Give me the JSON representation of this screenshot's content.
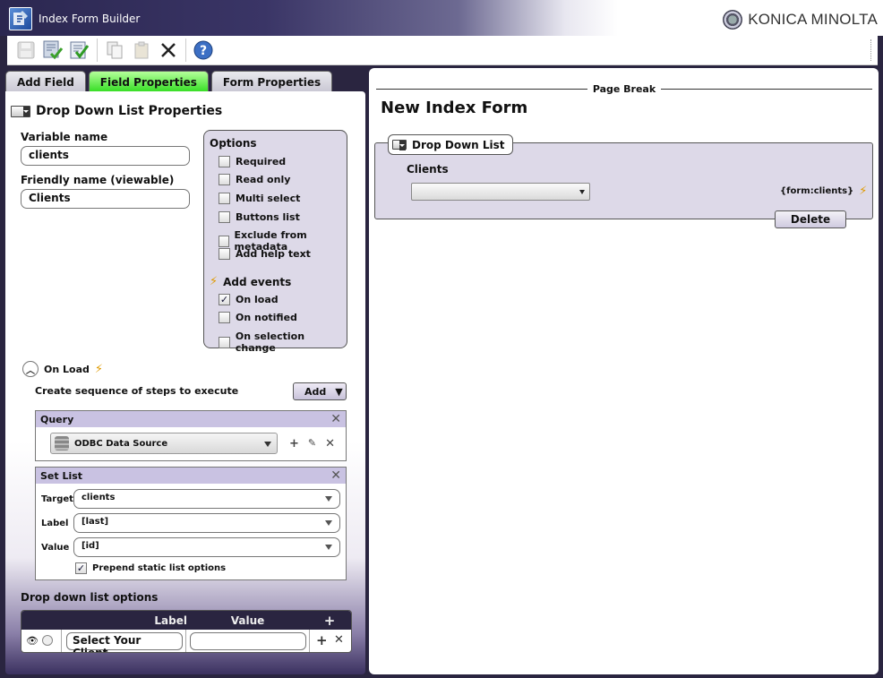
{
  "window": {
    "title": "Index Form Builder",
    "brand": "KONICA MINOLTA"
  },
  "toolbar": {
    "icons": [
      "save-icon",
      "save-and-check-icon",
      "validate-icon",
      "copy-icon",
      "paste-icon",
      "delete-icon",
      "help-icon"
    ]
  },
  "tabs": [
    {
      "label": "Add Field",
      "active": false
    },
    {
      "label": "Field Properties",
      "active": true
    },
    {
      "label": "Form Properties",
      "active": false
    }
  ],
  "properties": {
    "title": "Drop Down List Properties",
    "variable_name_label": "Variable name",
    "variable_name_value": "clients",
    "friendly_name_label": "Friendly name (viewable)",
    "friendly_name_value": "Clients"
  },
  "options": {
    "heading": "Options",
    "items": [
      {
        "label": "Required",
        "checked": false
      },
      {
        "label": "Read only",
        "checked": false
      },
      {
        "label": "Multi select",
        "checked": false
      },
      {
        "label": "Buttons list",
        "checked": false
      },
      {
        "label": "Exclude from metadata",
        "checked": false
      },
      {
        "label": "Add help text",
        "checked": false
      }
    ],
    "events_heading": "Add events",
    "events": [
      {
        "label": "On load",
        "checked": true
      },
      {
        "label": "On notified",
        "checked": false
      },
      {
        "label": "On selection change",
        "checked": false
      }
    ]
  },
  "onload": {
    "title": "On Load",
    "sequence_text": "Create sequence of steps to execute",
    "add_label": "Add",
    "query": {
      "title": "Query",
      "source": "ODBC Data Source"
    },
    "set_list": {
      "title": "Set List",
      "target_label": "Target",
      "target_value": "clients",
      "label_label": "Label",
      "label_value": "[last]",
      "value_label": "Value",
      "value_value": "[id]",
      "prepend_label": "Prepend static list options",
      "prepend_checked": true
    }
  },
  "dropdown_options": {
    "title": "Drop down list options",
    "col_label": "Label",
    "col_value": "Value",
    "add_symbol": "+",
    "rows": [
      {
        "label": "Select Your Client",
        "value": ""
      }
    ]
  },
  "canvas": {
    "page_break": "Page Break",
    "form_title": "New Index Form",
    "field_type": "Drop Down List",
    "field_label": "Clients",
    "field_variable": "{form:clients}",
    "delete_label": "Delete"
  }
}
